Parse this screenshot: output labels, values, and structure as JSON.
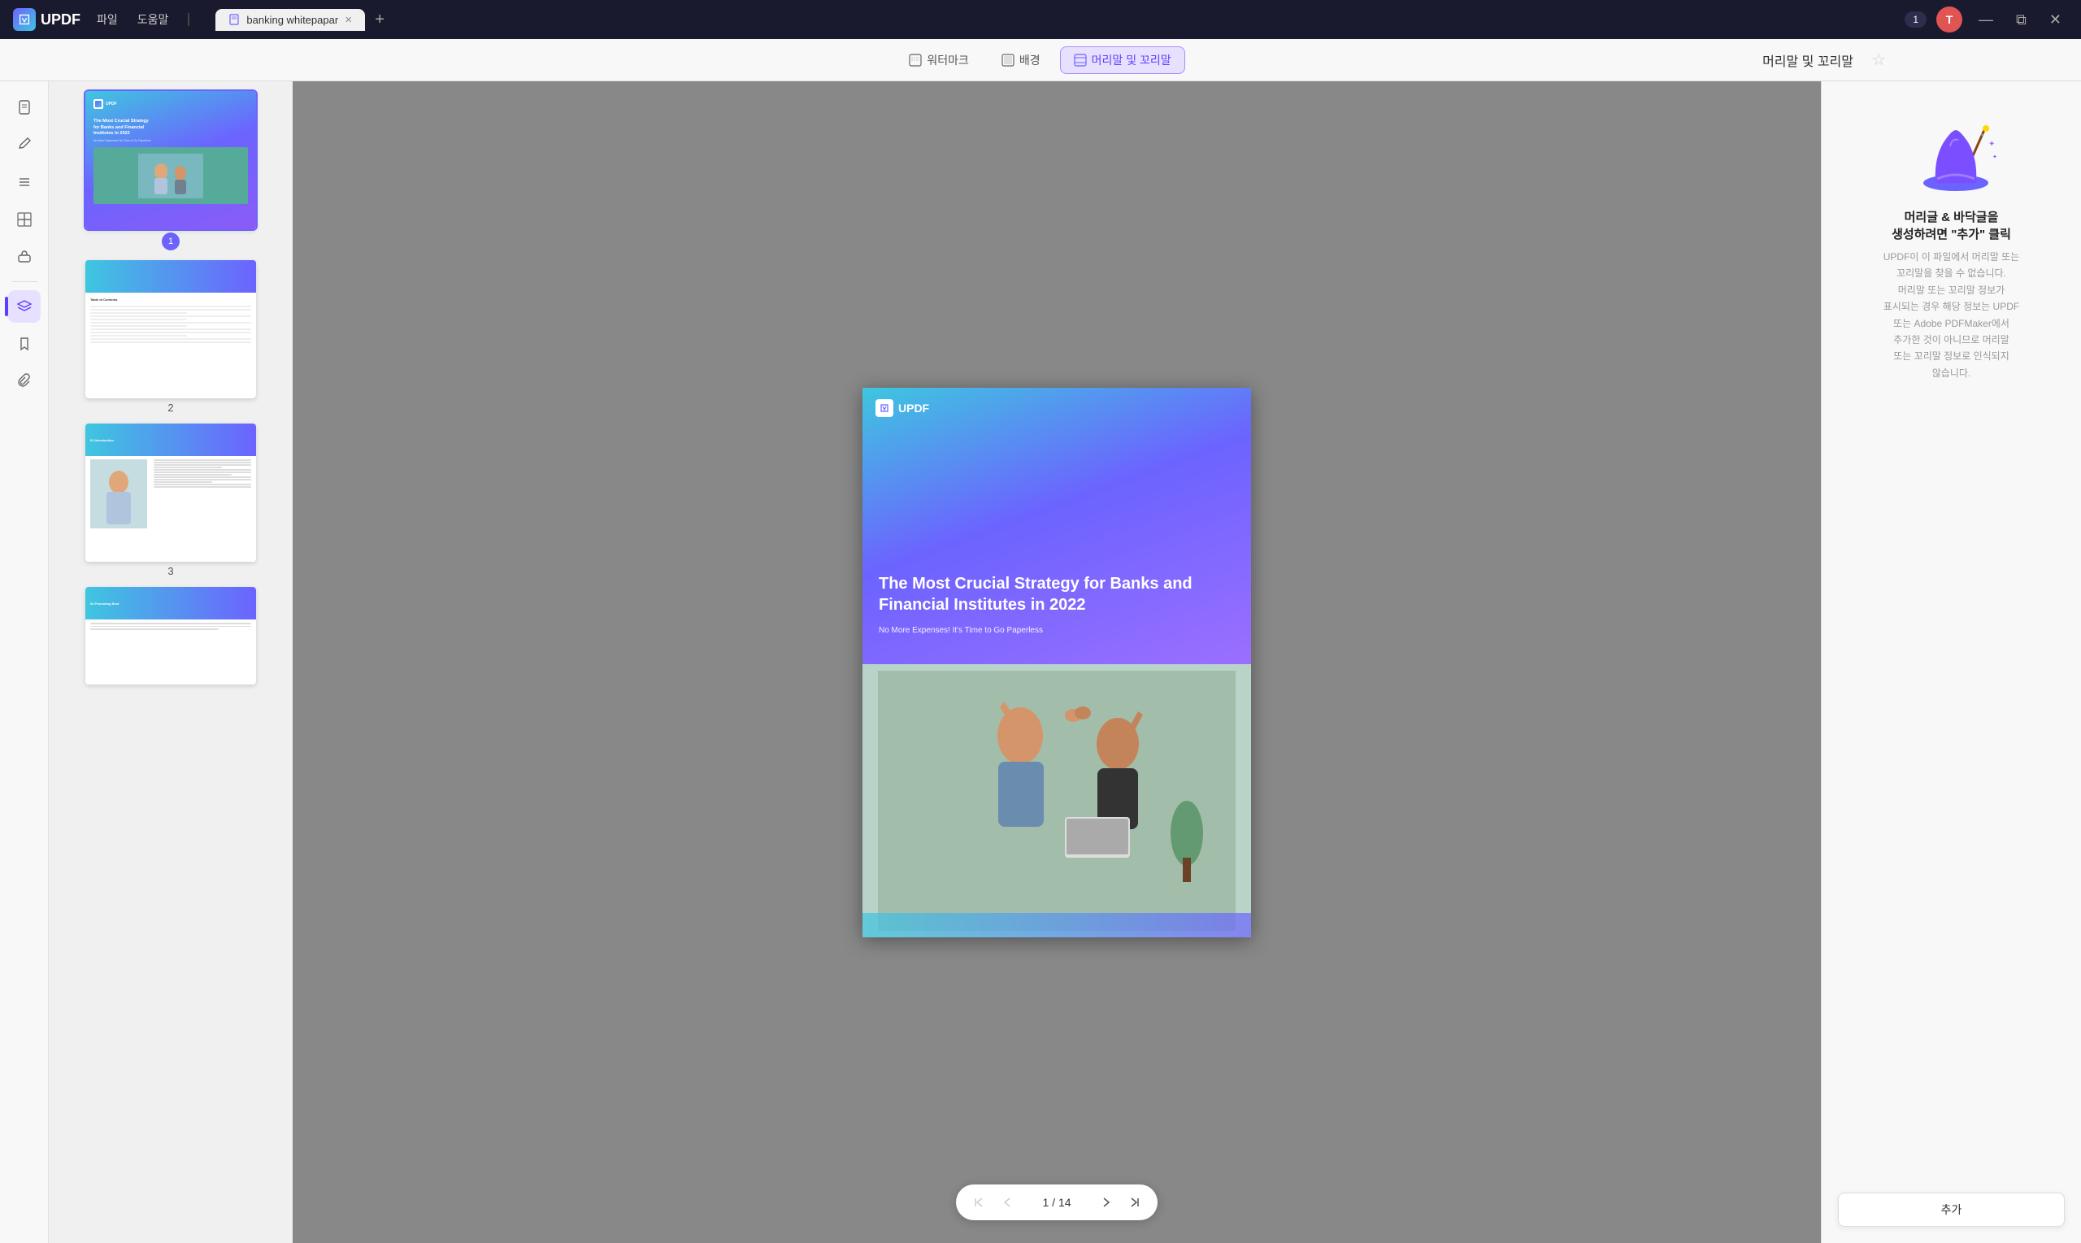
{
  "app": {
    "name": "UPDF",
    "logo_text": "UPDF"
  },
  "title_bar": {
    "menu_items": [
      "파일",
      "도움말"
    ],
    "tab_name": "banking whitepapar",
    "page_indicator": "1",
    "user_initial": "T",
    "window_buttons": [
      "—",
      "⧉",
      "✕"
    ],
    "plus_btn": "+"
  },
  "toolbar": {
    "watermark_label": "워터마크",
    "background_label": "배경",
    "header_footer_label": "머리말 및 꼬리말",
    "active_tool": "머리말 및 꼬리말",
    "right_title": "머리말 및 꼬리말"
  },
  "sidebar_icons": [
    {
      "name": "document-icon",
      "symbol": "📄",
      "active": false
    },
    {
      "name": "edit-icon",
      "symbol": "✏️",
      "active": false
    },
    {
      "name": "list-icon",
      "symbol": "≡",
      "active": false
    },
    {
      "name": "grid-icon",
      "symbol": "⊞",
      "active": false
    },
    {
      "name": "stamp-icon",
      "symbol": "🔖",
      "active": false
    },
    {
      "name": "layers-icon",
      "symbol": "⧉",
      "active": true
    },
    {
      "name": "bookmark-icon",
      "symbol": "🔖",
      "active": false
    },
    {
      "name": "paperclip-icon",
      "symbol": "📎",
      "active": false
    }
  ],
  "thumbnails": [
    {
      "page": 1,
      "label": "1",
      "type": "cover",
      "selected": true
    },
    {
      "page": 2,
      "label": "2",
      "type": "toc",
      "selected": false
    },
    {
      "page": 3,
      "label": "3",
      "type": "intro",
      "selected": false
    },
    {
      "page": 4,
      "label": "",
      "type": "promoting",
      "selected": false,
      "partial_text": "02 Promoting Best"
    }
  ],
  "pdf_page": {
    "updf_logo": "UPDF",
    "title": "The Most Crucial Strategy for Banks and Financial Institutes in 2022",
    "subtitle": "No More Expenses! It's Time to Go Paperless"
  },
  "navigation": {
    "current_page": "1",
    "separator": "/",
    "total_pages": "14"
  },
  "right_panel": {
    "title_line1": "머리글 & 바닥글을",
    "title_line2": "생성하려면 ",
    "highlight": "\"추가\"",
    "title_line3": " 클릭",
    "description": "UPDF이 이 파일에서 머리말 또는\n꼬리말을 찾을 수 없습니다.\n머리말 또는 꼬리말 정보가\n표시되는 경우 해당 정보는 UPDF\n또는 Adobe PDFMaker에서\n추가한 것이 아니므로 머리말\n또는 꼬리말 정보로 인식되지\n않습니다.",
    "add_button_label": "추가"
  }
}
